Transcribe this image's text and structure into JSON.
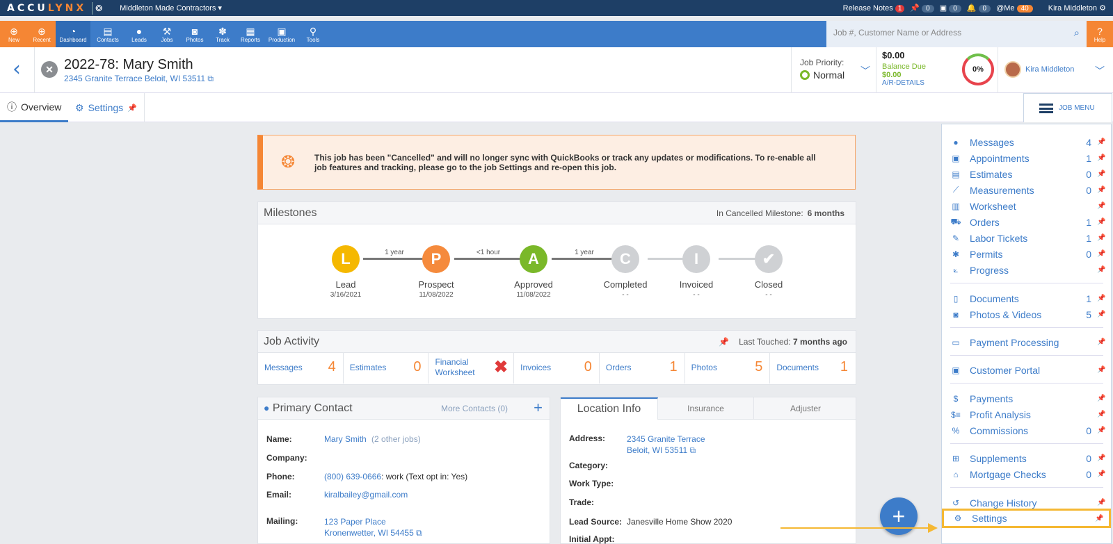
{
  "topbar": {
    "logo_a": "ACCU",
    "logo_b": "LYNX",
    "company": "Middleton Made Contractors",
    "release_notes": "Release Notes",
    "release_count": "1",
    "pin_count": "0",
    "cal_count": "0",
    "bell_count": "0",
    "me_label": "@Me",
    "me_count": "40",
    "user_name": "Kira Middleton"
  },
  "navbar": {
    "new": "New",
    "recent": "Recent",
    "items": [
      "Dashboard",
      "Contacts",
      "Leads",
      "Jobs",
      "Photos",
      "Track",
      "Reports",
      "Production",
      "Tools"
    ],
    "search_placeholder": "Job #, Customer Name or Address",
    "help": "Help"
  },
  "job": {
    "title": "2022-78: Mary Smith",
    "address": "2345 Granite Terrace Beloit, WI 53511",
    "priority_label": "Job Priority:",
    "priority_value": "Normal",
    "balance": "$0.00",
    "balance_due_label": "Balance Due",
    "balance_due": "$0.00",
    "ar_details": "A/R-DETAILS",
    "progress": "0%",
    "assigned_user": "Kira Middleton"
  },
  "tabs": {
    "overview": "Overview",
    "settings": "Settings",
    "job_menu": "JOB MENU"
  },
  "alert": "This job has been \"Cancelled\" and will no longer sync with QuickBooks or track any updates or modifications. To re-enable all job features and tracking, please go to the job Settings and re-open this job.",
  "milestones": {
    "title": "Milestones",
    "in_label": "In Cancelled Milestone:",
    "in_value": "6 months",
    "steps": [
      {
        "letter": "L",
        "name": "Lead",
        "date": "3/16/2021",
        "color": "#f5b800"
      },
      {
        "letter": "P",
        "name": "Prospect",
        "date": "11/08/2022",
        "color": "#f58a3c"
      },
      {
        "letter": "A",
        "name": "Approved",
        "date": "11/08/2022",
        "color": "#7ab829"
      },
      {
        "letter": "C",
        "name": "Completed",
        "date": "- -",
        "color": "#cfd1d4"
      },
      {
        "letter": "I",
        "name": "Invoiced",
        "date": "- -",
        "color": "#cfd1d4"
      },
      {
        "letter": "✔",
        "name": "Closed",
        "date": "- -",
        "color": "#cfd1d4"
      }
    ],
    "durations": [
      "1 year",
      "<1 hour",
      "1 year"
    ]
  },
  "activity": {
    "title": "Job Activity",
    "last_touched_label": "Last Touched:",
    "last_touched_value": "7 months ago",
    "cells": [
      {
        "label": "Messages",
        "count": "4"
      },
      {
        "label": "Estimates",
        "count": "0"
      },
      {
        "label": "Financial Worksheet",
        "count": "✖"
      },
      {
        "label": "Invoices",
        "count": "0"
      },
      {
        "label": "Orders",
        "count": "1"
      },
      {
        "label": "Photos",
        "count": "5"
      },
      {
        "label": "Documents",
        "count": "1"
      }
    ]
  },
  "contact": {
    "title": "Primary Contact",
    "more": "More Contacts (0)",
    "name_k": "Name:",
    "name_v": "Mary Smith",
    "name_extra": "(2 other jobs)",
    "company_k": "Company:",
    "phone_k": "Phone:",
    "phone_v": "(800) 639-0666",
    "phone_extra": ": work (Text opt in: Yes)",
    "email_k": "Email:",
    "email_v": "kiralbailey@gmail.com",
    "mailing_k": "Mailing:",
    "mailing_1": "123 Paper Place",
    "mailing_2": "Kronenwetter, WI 54455"
  },
  "location": {
    "tab_location": "Location Info",
    "tab_insurance": "Insurance",
    "tab_adjuster": "Adjuster",
    "address_k": "Address:",
    "address_1": "2345 Granite Terrace",
    "address_2": "Beloit, WI 53511",
    "category_k": "Category:",
    "worktype_k": "Work Type:",
    "trade_k": "Trade:",
    "leadsource_k": "Lead Source:",
    "leadsource_v": "Janesville Home Show 2020",
    "initial_k": "Initial Appt:"
  },
  "menu": [
    {
      "label": "Messages",
      "count": "4",
      "icon": "chat-icon"
    },
    {
      "label": "Appointments",
      "count": "1",
      "icon": "calendar-icon"
    },
    {
      "label": "Estimates",
      "count": "0",
      "icon": "doc-icon"
    },
    {
      "label": "Measurements",
      "count": "0",
      "icon": "ruler-icon"
    },
    {
      "label": "Worksheet",
      "count": "",
      "icon": "worksheet-icon"
    },
    {
      "label": "Orders",
      "count": "1",
      "icon": "cart-icon"
    },
    {
      "label": "Labor Tickets",
      "count": "1",
      "icon": "ticket-icon"
    },
    {
      "label": "Permits",
      "count": "0",
      "icon": "asterisk-icon"
    },
    {
      "label": "Progress",
      "count": "",
      "icon": "chart-icon"
    },
    {
      "label": "Documents",
      "count": "1",
      "icon": "file-icon"
    },
    {
      "label": "Photos & Videos",
      "count": "5",
      "icon": "camera-icon"
    },
    {
      "label": "Payment Processing",
      "count": "",
      "icon": "card-icon"
    },
    {
      "label": "Customer Portal",
      "count": "",
      "icon": "portal-icon"
    },
    {
      "label": "Payments",
      "count": "",
      "icon": "dollar-icon"
    },
    {
      "label": "Profit Analysis",
      "count": "",
      "icon": "profit-icon"
    },
    {
      "label": "Commissions",
      "count": "0",
      "icon": "percent-icon"
    },
    {
      "label": "Supplements",
      "count": "0",
      "icon": "plus-square-icon"
    },
    {
      "label": "Mortgage Checks",
      "count": "0",
      "icon": "home-icon"
    },
    {
      "label": "Change History",
      "count": "",
      "icon": "history-icon"
    },
    {
      "label": "Settings",
      "count": "",
      "icon": "gear-icon"
    }
  ]
}
